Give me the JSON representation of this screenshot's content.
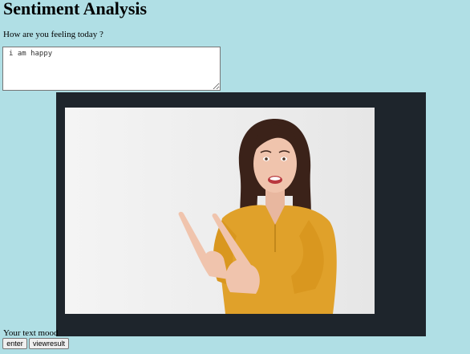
{
  "header": {
    "title": "Sentiment Analysis"
  },
  "form": {
    "prompt": "How are you feeling today ?",
    "input_value": "i am happy",
    "mood_label": "Your text mood",
    "enter_label": "enter",
    "viewresult_label": "viewresult"
  },
  "result": {
    "image": "smiling-woman-pointing-photo",
    "panel_color": "#1e252c"
  },
  "colors": {
    "page_background": "#b0dfe5"
  }
}
